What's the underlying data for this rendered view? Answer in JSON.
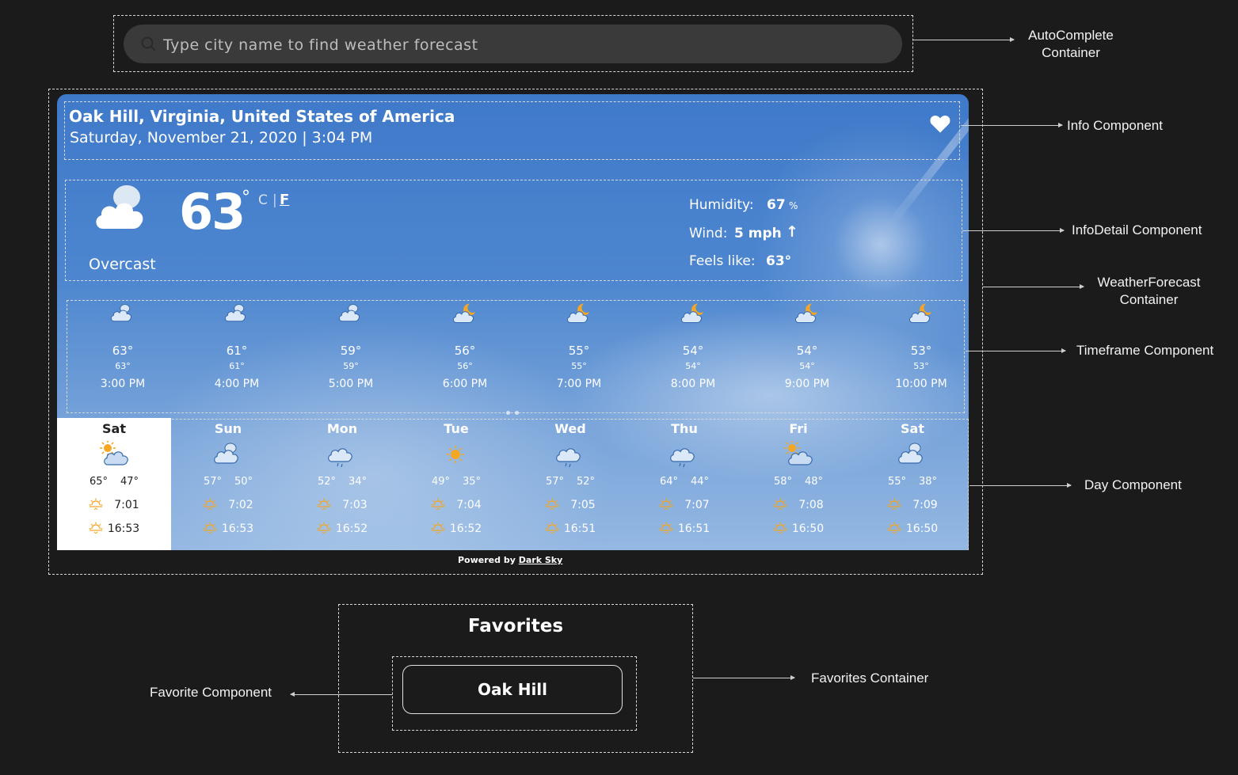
{
  "search": {
    "placeholder": "Type city name to find weather forecast"
  },
  "info": {
    "location": "Oak Hill, Virginia, United States of America",
    "datetime": "Saturday, November 21, 2020 | 3:04 PM"
  },
  "current": {
    "temp": "63",
    "deg": "°",
    "unit_c": "C",
    "unit_sep": "|",
    "unit_f": "F",
    "summary": "Overcast",
    "humidity_label": "Humidity:",
    "humidity_value": "67",
    "humidity_unit": "%",
    "wind_label": "Wind:",
    "wind_value": "5 mph",
    "wind_arrow": "↑",
    "feels_label": "Feels like:",
    "feels_value": "63°"
  },
  "hourly": [
    {
      "icon": "cloud-icon",
      "temp": "63°",
      "feels": "63°",
      "time": "3:00 PM"
    },
    {
      "icon": "cloud-icon",
      "temp": "61°",
      "feels": "61°",
      "time": "4:00 PM"
    },
    {
      "icon": "cloud-icon",
      "temp": "59°",
      "feels": "59°",
      "time": "5:00 PM"
    },
    {
      "icon": "cloud-moon-icon",
      "temp": "56°",
      "feels": "56°",
      "time": "6:00 PM"
    },
    {
      "icon": "cloud-moon-icon",
      "temp": "55°",
      "feels": "55°",
      "time": "7:00 PM"
    },
    {
      "icon": "cloud-moon-icon",
      "temp": "54°",
      "feels": "54°",
      "time": "8:00 PM"
    },
    {
      "icon": "cloud-moon-icon",
      "temp": "54°",
      "feels": "54°",
      "time": "9:00 PM"
    },
    {
      "icon": "cloud-moon-icon",
      "temp": "53°",
      "feels": "53°",
      "time": "10:00 PM"
    }
  ],
  "days": [
    {
      "name": "Sat",
      "icon": "partly-sunny-icon",
      "high": "65°",
      "low": "47°",
      "sunrise": "7:01",
      "sunset": "16:53"
    },
    {
      "name": "Sun",
      "icon": "cloud-icon",
      "high": "57°",
      "low": "50°",
      "sunrise": "7:02",
      "sunset": "16:53"
    },
    {
      "name": "Mon",
      "icon": "rain-cloud-icon",
      "high": "52°",
      "low": "34°",
      "sunrise": "7:03",
      "sunset": "16:52"
    },
    {
      "name": "Tue",
      "icon": "sun-icon",
      "high": "49°",
      "low": "35°",
      "sunrise": "7:04",
      "sunset": "16:52"
    },
    {
      "name": "Wed",
      "icon": "rain-cloud-icon",
      "high": "57°",
      "low": "52°",
      "sunrise": "7:05",
      "sunset": "16:51"
    },
    {
      "name": "Thu",
      "icon": "rain-cloud-icon",
      "high": "64°",
      "low": "44°",
      "sunrise": "7:07",
      "sunset": "16:51"
    },
    {
      "name": "Fri",
      "icon": "partly-sunny-icon",
      "high": "58°",
      "low": "48°",
      "sunrise": "7:08",
      "sunset": "16:50"
    },
    {
      "name": "Sat",
      "icon": "cloud-icon",
      "high": "55°",
      "low": "38°",
      "sunrise": "7:09",
      "sunset": "16:50"
    }
  ],
  "powered": {
    "prefix": "Powered by",
    "link": "Dark Sky"
  },
  "favorites": {
    "title": "Favorites",
    "items": [
      "Oak Hill"
    ]
  },
  "annotations": {
    "autocomplete": "AutoComplete\nContainer",
    "info": "Info Component",
    "infodetail": "InfoDetail Component",
    "forecast": "WeatherForecast\nContainer",
    "timeframe": "Timeframe Component",
    "day": "Day Component",
    "favorites_container": "Favorites Container",
    "favorite": "Favorite Component"
  },
  "colors": {
    "background": "#1b1b1b",
    "card_top": "#3f79c9",
    "sun": "#f5a623",
    "selected_day": "#ffffff"
  }
}
